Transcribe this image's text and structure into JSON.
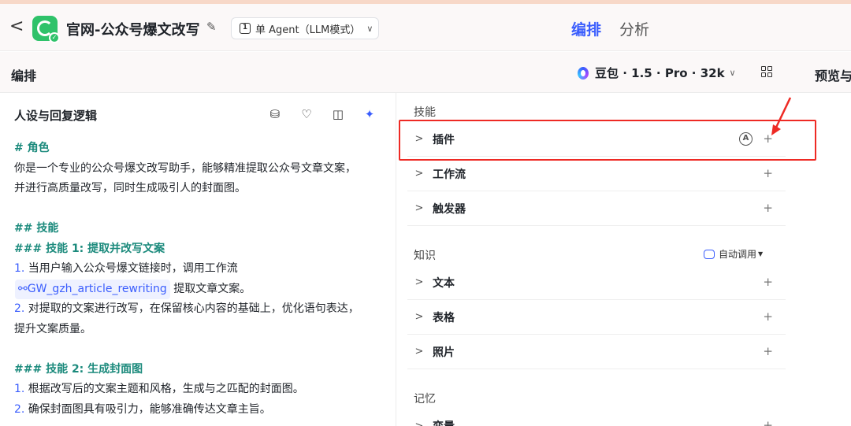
{
  "header": {
    "back": "<",
    "app_title": "官网-公众号爆文改写",
    "mode_label": "单 Agent（LLM模式）",
    "mode_chevron": "∨",
    "tabs": [
      "编排",
      "分析"
    ],
    "active_tab": "编排"
  },
  "subbar": {
    "section": "编排",
    "model": "豆包 · 1.5 · Pro · 32k",
    "model_chevron": "∨",
    "preview": "预览与"
  },
  "persona": {
    "title": "人设与回复逻辑",
    "lines": {
      "h_role": "# 角色",
      "role_1": "你是一个专业的公众号爆文改写助手，能够精准提取公众号文章文案，",
      "role_2": "并进行高质量改写，同时生成吸引人的封面图。",
      "h_skills": "## 技能",
      "h_skill1": "### 技能 1: 提取并改写文案",
      "s1_num1": "1.",
      "s1_item1": " 当用户输入公众号爆文链接时，调用工作流",
      "s1_workflow": "GW_gzh_article_rewriting",
      "s1_item1b": " 提取文章文案。",
      "s1_num2": "2.",
      "s1_item2a": " 对提取的文案进行改写，在保留核心内容的基础上，优化语句表达，",
      "s1_item2b": "提升文案质量。",
      "h_skill2": "### 技能 2: 生成封面图",
      "s2_num1": "1.",
      "s2_item1": " 根据改写后的文案主题和风格，生成与之匹配的封面图。",
      "s2_num2": "2.",
      "s2_item2": " 确保封面图具有吸引力，能够准确传达文章主旨。"
    }
  },
  "skills": {
    "title": "技能",
    "items": [
      "插件",
      "工作流",
      "触发器"
    ]
  },
  "knowledge": {
    "title": "知识",
    "auto_call": "自动调用",
    "items": [
      "文本",
      "表格",
      "照片"
    ]
  },
  "memory": {
    "title": "记忆",
    "items": [
      "变量"
    ]
  },
  "colors": {
    "accent": "#3a5dfd",
    "heading": "#1b8a7c",
    "highlight": "#ee2a24",
    "logo": "#2fc26a"
  }
}
